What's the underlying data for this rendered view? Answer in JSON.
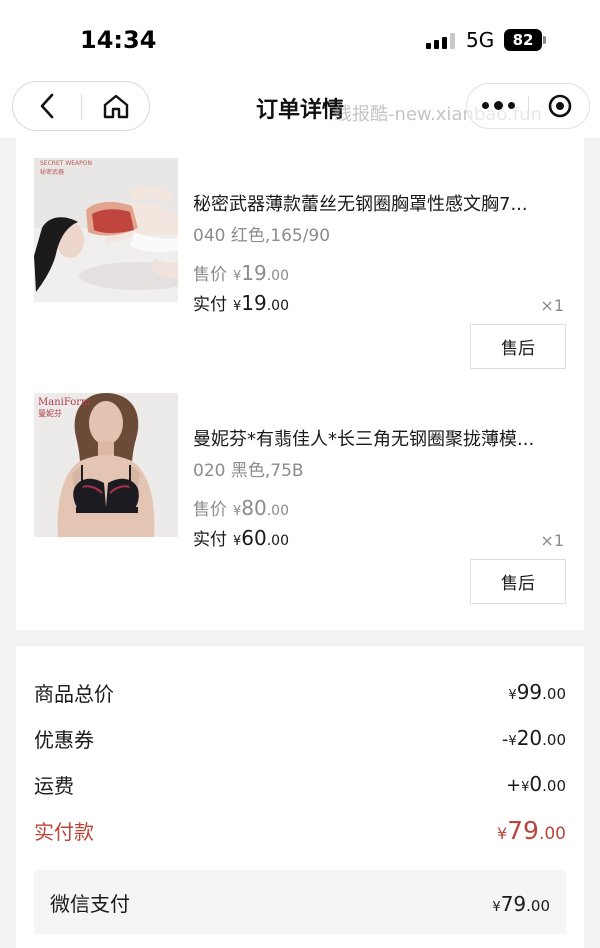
{
  "status_bar": {
    "time": "14:34",
    "network": "5G",
    "battery": "82"
  },
  "nav": {
    "title": "订单详情",
    "watermark": "线报酷-new.xianbao.fun"
  },
  "items": [
    {
      "name": "秘密武器薄款蕾丝无钢圈胸罩性感文胸7...",
      "spec": "040 红色,165/90",
      "sale_label": "售价",
      "sale_int": "19",
      "sale_dec": ".00",
      "paid_label": "实付",
      "paid_int": "19",
      "paid_dec": ".00",
      "qty": "×1",
      "after_sale": "售后",
      "brand_top": "SECRET WEAPON",
      "brand_sub": "秘密武器"
    },
    {
      "name": "曼妮芬*有翡佳人*长三角无钢圈聚拢薄模...",
      "spec": "020 黑色,75B",
      "sale_label": "售价",
      "sale_int": "80",
      "sale_dec": ".00",
      "paid_label": "实付",
      "paid_int": "60",
      "paid_dec": ".00",
      "qty": "×1",
      "after_sale": "售后",
      "brand_top": "ManiForm",
      "brand_sub": "曼妮芬"
    }
  ],
  "summary": {
    "currency": "¥",
    "total_label": "商品总价",
    "total_int": "99",
    "total_dec": ".00",
    "coupon_label": "优惠券",
    "coupon_sign": "-",
    "coupon_int": "20",
    "coupon_dec": ".00",
    "shipping_label": "运费",
    "shipping_sign": "+",
    "shipping_int": "0",
    "shipping_dec": ".00",
    "paid_label": "实付款",
    "paid_int": "79",
    "paid_dec": ".00",
    "method_label": "微信支付",
    "method_int": "79",
    "method_dec": ".00"
  },
  "colors": {
    "accent_red": "#b8463b",
    "muted": "#8c8c8c",
    "background": "#f2f2f2"
  }
}
